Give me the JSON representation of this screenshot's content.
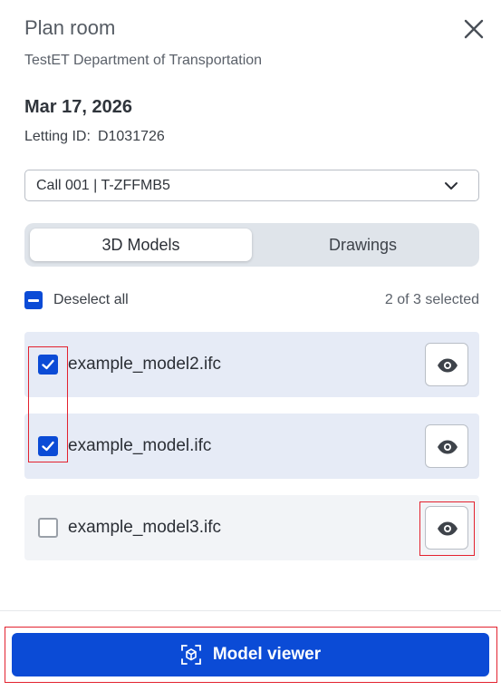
{
  "header": {
    "title": "Plan room",
    "subtitle": "TestET Department of Transportation"
  },
  "letting": {
    "date": "Mar 17, 2026",
    "id_label": "Letting ID:",
    "id_value": "D1031726"
  },
  "call_select": {
    "value": "Call 001 | T-ZFFMB5"
  },
  "tabs": [
    {
      "label": "3D Models",
      "active": true
    },
    {
      "label": "Drawings",
      "active": false
    }
  ],
  "selection": {
    "deselect_label": "Deselect all",
    "count_text": "2 of 3 selected"
  },
  "files": [
    {
      "name": "example_model2.ifc",
      "checked": true
    },
    {
      "name": "example_model.ifc",
      "checked": true
    },
    {
      "name": "example_model3.ifc",
      "checked": false
    }
  ],
  "footer": {
    "model_viewer_label": "Model viewer"
  },
  "colors": {
    "primary": "#0b4bd6",
    "selected_row": "#e6ebf6",
    "unselected_row": "#f2f4f7",
    "highlight": "#e3222f"
  },
  "icons": {
    "close": "close-icon",
    "dropdown": "chevron-down-icon",
    "deselect": "minus-checkbox-icon",
    "view": "eye-icon",
    "model_viewer": "cube-scan-icon"
  }
}
